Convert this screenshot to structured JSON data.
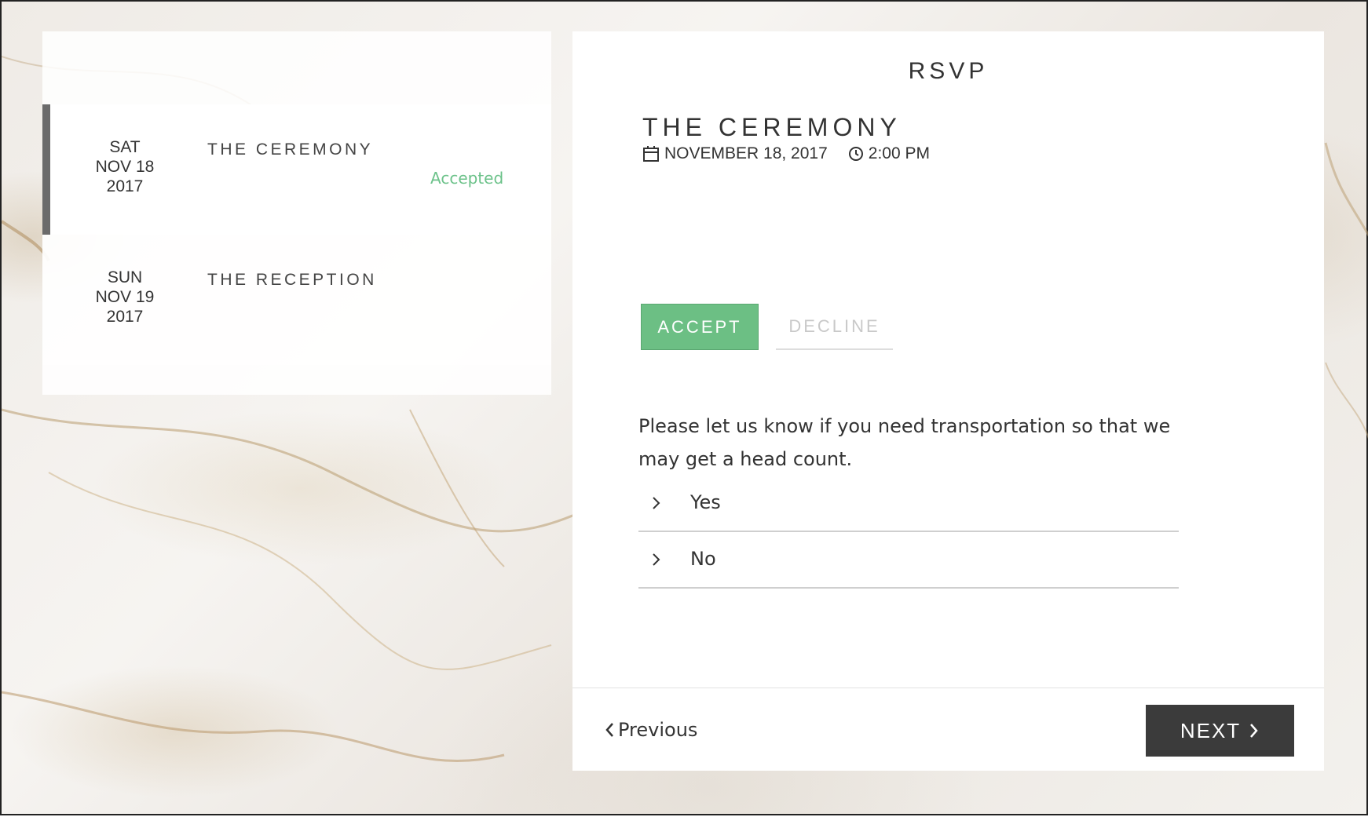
{
  "events": [
    {
      "day": "SAT",
      "month_day": "NOV 18",
      "year": "2017",
      "name": "THE CEREMONY",
      "status": "Accepted"
    },
    {
      "day": "SUN",
      "month_day": "NOV 19",
      "year": "2017",
      "name": "THE RECEPTION",
      "status": ""
    }
  ],
  "rsvp": {
    "title": "RSVP",
    "event_title": "THE CEREMONY",
    "date": "NOVEMBER 18, 2017",
    "time": "2:00 PM",
    "accept_label": "ACCEPT",
    "decline_label": "DECLINE",
    "question": "Please let us know if you need transportation so that we may get a head count.",
    "options": [
      "Yes",
      "No"
    ]
  },
  "nav": {
    "previous_label": "Previous",
    "next_label": "NEXT"
  },
  "colors": {
    "accept_green": "#6cbf84",
    "accepted_text": "#6cc28a",
    "next_button": "#3b3b3b",
    "active_indicator": "#6b6b6b"
  },
  "icons": [
    "calendar-icon",
    "clock-icon",
    "chevron-right-icon",
    "chevron-left-icon"
  ]
}
